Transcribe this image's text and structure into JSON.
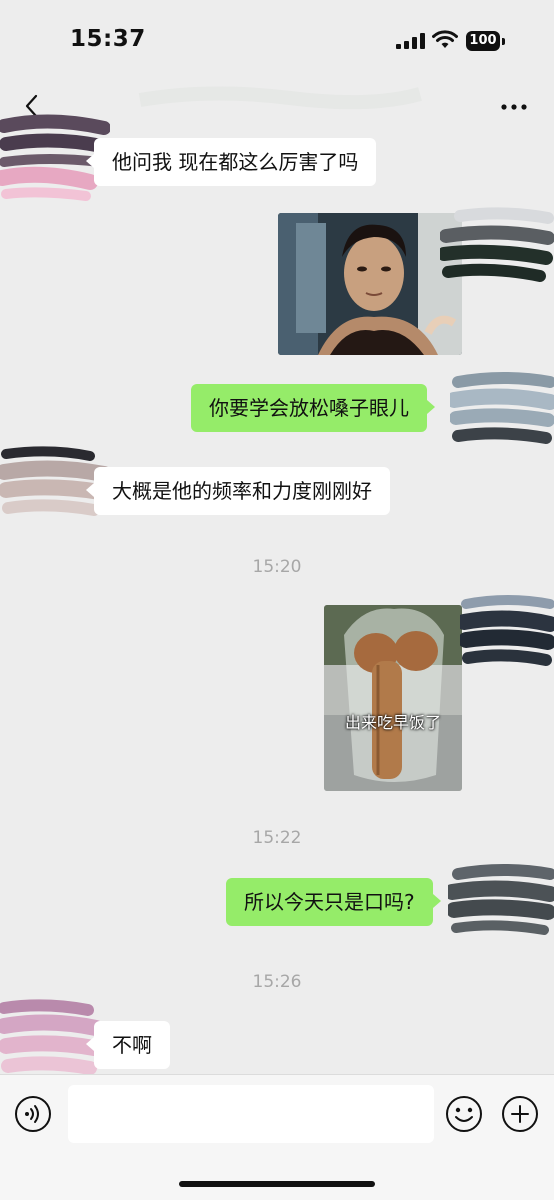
{
  "status_bar": {
    "time": "15:37",
    "battery": "100"
  },
  "nav": {
    "back_icon": "chevron-left-icon",
    "more_icon": "ellipsis-icon"
  },
  "messages": [
    {
      "type": "text",
      "direction": "in",
      "text": "他问我 现在都这么厉害了吗"
    },
    {
      "type": "image",
      "direction": "out",
      "icon": "photo-of-man-image"
    },
    {
      "type": "text",
      "direction": "out",
      "text": "你要学会放松嗓子眼儿"
    },
    {
      "type": "text",
      "direction": "in",
      "text": "大概是他的频率和力度刚刚好"
    },
    {
      "type": "timestamp",
      "text": "15:20"
    },
    {
      "type": "sticker",
      "direction": "out",
      "caption": "出来吃早饭了"
    },
    {
      "type": "timestamp",
      "text": "15:22"
    },
    {
      "type": "text",
      "direction": "out",
      "text": "所以今天只是口吗?"
    },
    {
      "type": "timestamp",
      "text": "15:26"
    },
    {
      "type": "text",
      "direction": "in",
      "text": "不啊"
    }
  ],
  "input_bar": {
    "voice_icon": "voice-icon",
    "input_value": "",
    "emoji_icon": "emoji-icon",
    "plus_icon": "plus-icon"
  },
  "colors": {
    "background": "#ededed",
    "outgoing_bubble": "#95ec69",
    "incoming_bubble": "#ffffff",
    "timestamp": "#a7a7a7"
  }
}
